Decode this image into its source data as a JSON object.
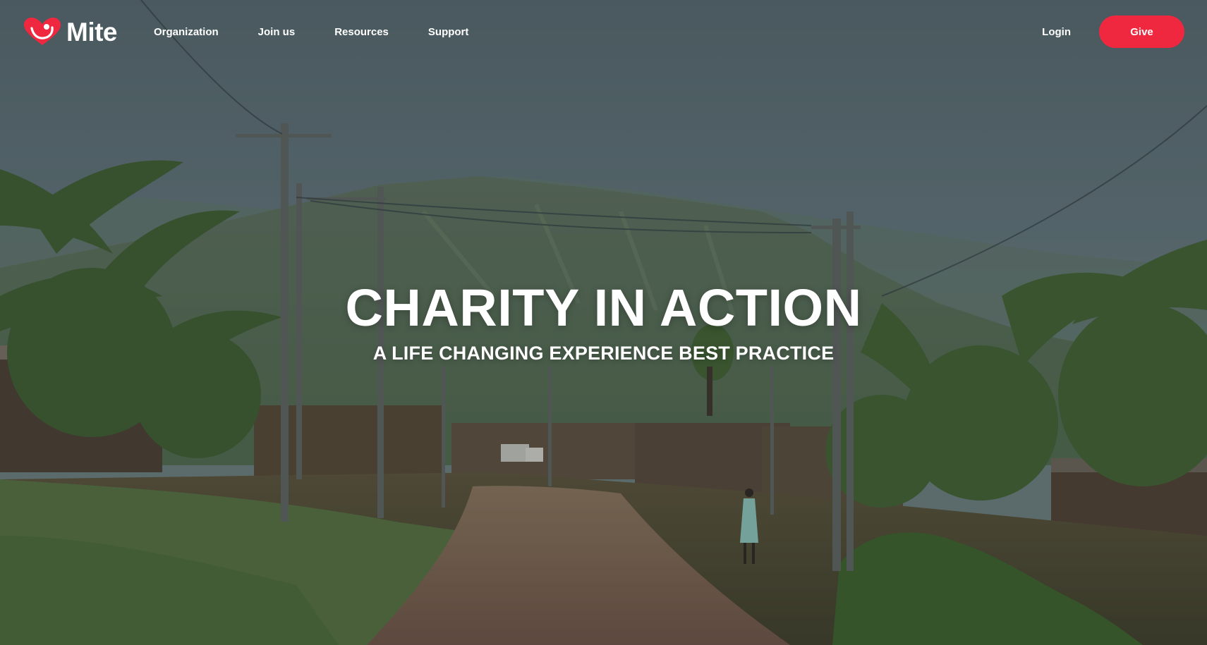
{
  "brand": {
    "name": "Mite",
    "logo_icon": "heart-hand-icon",
    "accent_color": "#f0283f"
  },
  "nav": {
    "items": [
      {
        "label": "Organization"
      },
      {
        "label": "Join us"
      },
      {
        "label": "Resources"
      },
      {
        "label": "Support"
      }
    ],
    "login_label": "Login",
    "give_label": "Give"
  },
  "hero": {
    "title": "CHARITY IN ACTION",
    "subtitle": "A LIFE CHANGING EXPERIENCE BEST PRACTICE",
    "background": "village-dirt-road-mountain-photo"
  }
}
